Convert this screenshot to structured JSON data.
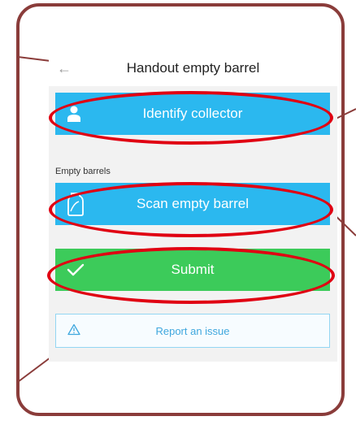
{
  "header": {
    "title": "Handout empty barrel",
    "back_icon": "back-arrow-icon"
  },
  "identify": {
    "label": "Identify collector",
    "icon": "person-icon"
  },
  "section": {
    "empty_barrels_label": "Empty barrels"
  },
  "scan": {
    "label": "Scan empty barrel",
    "icon": "barrel-icon"
  },
  "submit": {
    "label": "Submit",
    "icon": "checkmark-icon"
  },
  "report": {
    "label": "Report an issue",
    "icon": "warning-icon"
  },
  "colors": {
    "frame": "#8a3c3a",
    "highlight": "#e00012",
    "blue_button": "#2bb8ef",
    "green_button": "#3ccb5a",
    "link": "#3fa7de"
  }
}
